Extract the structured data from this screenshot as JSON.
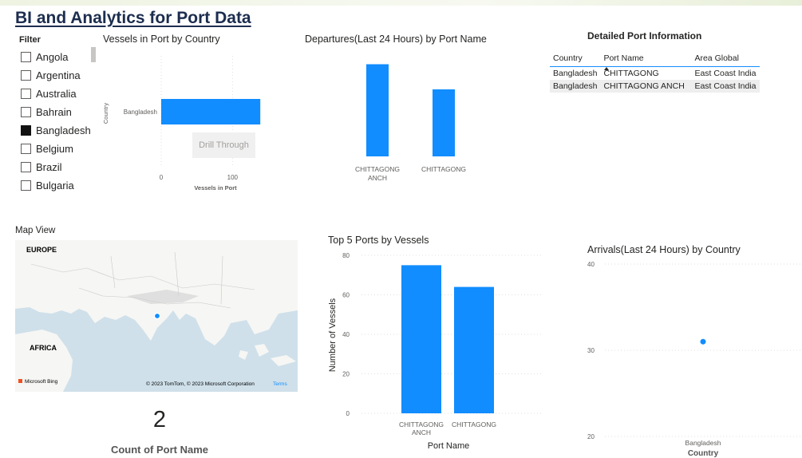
{
  "page_title": "BI and Analytics for Port Data",
  "filter": {
    "title": "Filter",
    "items": [
      {
        "label": "Angola",
        "checked": false
      },
      {
        "label": "Argentina",
        "checked": false
      },
      {
        "label": "Australia",
        "checked": false
      },
      {
        "label": "Bahrain",
        "checked": false
      },
      {
        "label": "Bangladesh",
        "checked": true
      },
      {
        "label": "Belgium",
        "checked": false
      },
      {
        "label": "Brazil",
        "checked": false
      },
      {
        "label": "Bulgaria",
        "checked": false
      }
    ]
  },
  "drill_through_label": "Drill Through",
  "detail_table": {
    "title": "Detailed Port Information",
    "columns": [
      "Country",
      "Port Name",
      "Area Global"
    ],
    "rows": [
      [
        "Bangladesh",
        "CHITTAGONG",
        "East Coast India"
      ],
      [
        "Bangladesh",
        "CHITTAGONG ANCH",
        "East Coast India"
      ]
    ]
  },
  "map": {
    "title": "Map View",
    "labels": {
      "europe": "EUROPE",
      "africa": "AFRICA"
    },
    "copyright": "© 2023 TomTom, © 2023 Microsoft Corporation",
    "terms": "Terms",
    "bing": "Microsoft Bing",
    "land_color": "#f6f6f4",
    "water_color": "#cfe0ea"
  },
  "kpi": {
    "value": "2",
    "label": "Count of Port Name"
  },
  "colors": {
    "bar": "#118dff",
    "text": "#252423",
    "axis_text": "#605e5c",
    "grid": "#e1dfdd"
  },
  "chart_data": [
    {
      "id": "vessels-by-country",
      "type": "bar",
      "orientation": "horizontal",
      "title": "Vessels in Port by Country",
      "xlabel": "Vessels in Port",
      "ylabel": "Country",
      "categories": [
        "Bangladesh"
      ],
      "values": [
        139
      ],
      "xlim": [
        0,
        150
      ],
      "xticks": [
        "0",
        "100"
      ]
    },
    {
      "id": "departures-by-port",
      "type": "bar",
      "title": "Departures(Last 24 Hours) by Port Name",
      "categories": [
        "CHITTAGONG ANCH",
        "CHITTAGONG"
      ],
      "tick_lines": [
        [
          "CHITTAGONG",
          "ANCH"
        ],
        [
          "CHITTAGONG"
        ]
      ],
      "values": [
        11,
        8
      ],
      "ylim": [
        0,
        12
      ]
    },
    {
      "id": "top5-ports",
      "type": "bar",
      "title": "Top 5 Ports by Vessels",
      "xlabel": "Port Name",
      "ylabel": "Number of Vessels",
      "categories": [
        "CHITTAGONG ANCH",
        "CHITTAGONG"
      ],
      "tick_lines": [
        [
          "CHITTAGONG",
          "ANCH"
        ],
        [
          "CHITTAGONG"
        ]
      ],
      "values": [
        75,
        64
      ],
      "ylim": [
        0,
        80
      ],
      "yticks": [
        0,
        20,
        40,
        60,
        80
      ],
      "grid": true
    },
    {
      "id": "arrivals-by-country",
      "type": "scatter",
      "title": "Arrivals(Last 24 Hours) by Country",
      "xlabel": "Country",
      "categories": [
        "Bangladesh"
      ],
      "values": [
        31
      ],
      "ylim": [
        20,
        40
      ],
      "yticks": [
        20,
        30,
        40
      ],
      "grid": true
    }
  ]
}
